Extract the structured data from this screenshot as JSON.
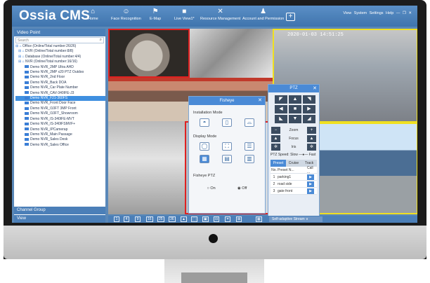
{
  "app": {
    "logo": "Ossia CMS",
    "nav": [
      {
        "label": "Home",
        "icon": "home-icon",
        "glyph": "⌂"
      },
      {
        "label": "Face Recognition",
        "icon": "face-recognition-icon",
        "glyph": "☺"
      },
      {
        "label": "E-Map",
        "icon": "flag-icon",
        "glyph": "⚑"
      },
      {
        "label": "Live View1*",
        "icon": "camera-icon",
        "glyph": "■"
      },
      {
        "label": "Resource Management",
        "icon": "tools-icon",
        "glyph": "✕"
      },
      {
        "label": "Account and Permission",
        "icon": "account-icon",
        "glyph": "♟"
      }
    ],
    "add_tab": "+",
    "top_right": {
      "view": "View",
      "system": "System",
      "settings": "Settings",
      "help": "Help",
      "minimize": "—",
      "restore": "❐",
      "close": "✕"
    }
  },
  "sidebar": {
    "header": "Video Point",
    "search_placeholder": "Search",
    "tree": [
      {
        "label": "Office (Online/Total number:26/26)",
        "level": 0
      },
      {
        "label": "DVR (Online/Total number:8/8)",
        "level": 1
      },
      {
        "label": "Database (Online/Total number:4/4)",
        "level": 1
      },
      {
        "label": "NVR (Online/Total number:16/16)",
        "level": 1
      },
      {
        "label": "Demo NVR_2MP Ultra AHD",
        "level": 2
      },
      {
        "label": "Demo NVR_2MP x20 PTZ Outdoo",
        "level": 2
      },
      {
        "label": "Demo NVR_2nd Floor",
        "level": 2
      },
      {
        "label": "Demo NVR_Back DOA",
        "level": 2
      },
      {
        "label": "Demo NVR_Car Plate Number",
        "level": 2
      },
      {
        "label": "Demo NVR_CAV-340IFE-J3",
        "level": 2
      },
      {
        "label": "Demo NVR_F21-360FS",
        "level": 2,
        "selected": true
      },
      {
        "label": "Demo NVR_Front Door Face",
        "level": 2
      },
      {
        "label": "Demo NVR_I10FT 3MP Front",
        "level": 2
      },
      {
        "label": "Demo NVR_I10FT_Showroom",
        "level": 2
      },
      {
        "label": "Demo NVR_IS-340IFE-MVT",
        "level": 2
      },
      {
        "label": "Demo NVR_IS-340IFSMVF+",
        "level": 2
      },
      {
        "label": "Demo NVR_IPCamerap",
        "level": 2
      },
      {
        "label": "Demo NVR_Main Passage",
        "level": 2
      },
      {
        "label": "Demo NVR_Sales Desk",
        "level": 2
      },
      {
        "label": "Demo NVR_Sales Office",
        "level": 2
      }
    ],
    "channel_group": "Channel Group",
    "view": "View"
  },
  "video": {
    "timestamp": "2020-01-03 14:51:25"
  },
  "fisheye": {
    "title": "Fisheye",
    "close": "✕",
    "installation_mode": "Installation Mode",
    "install_icons": [
      "◓",
      "▯",
      "⌓"
    ],
    "display_mode": "Display Mode",
    "display_icons_row1": [
      "◯",
      "⛶",
      "☰"
    ],
    "display_icons_row2": [
      "▦",
      "▤",
      "▥"
    ],
    "ptz_label": "Fisheye PTZ",
    "on": "On",
    "off": "Off"
  },
  "ptz": {
    "title": "PTZ",
    "close": "✕",
    "arrows": [
      "◤",
      "▲",
      "◥",
      "◀",
      "■",
      "▶",
      "◣",
      "▼",
      "◢"
    ],
    "zoom": "Zoom",
    "focus": "Focus",
    "iris": "Iris",
    "speed_label": "PTZ Speed: Slow",
    "speed_fast": "Fast",
    "tabs": [
      "Preset",
      "Cruise",
      "Track"
    ],
    "table_header": [
      "No.",
      "Preset N...",
      "Call ..."
    ],
    "presets": [
      {
        "no": "1",
        "name": "parking1"
      },
      {
        "no": "2",
        "name": "road side"
      },
      {
        "no": "3",
        "name": "gate front"
      }
    ]
  },
  "toolbar": {
    "buttons": [
      "1",
      "4",
      "9",
      "16",
      "25",
      "36",
      "▲",
      "⬚",
      "▣",
      "⊟",
      "⌗",
      "⊠",
      "▦"
    ],
    "stream": "Self-adaptive Stream ∨"
  }
}
